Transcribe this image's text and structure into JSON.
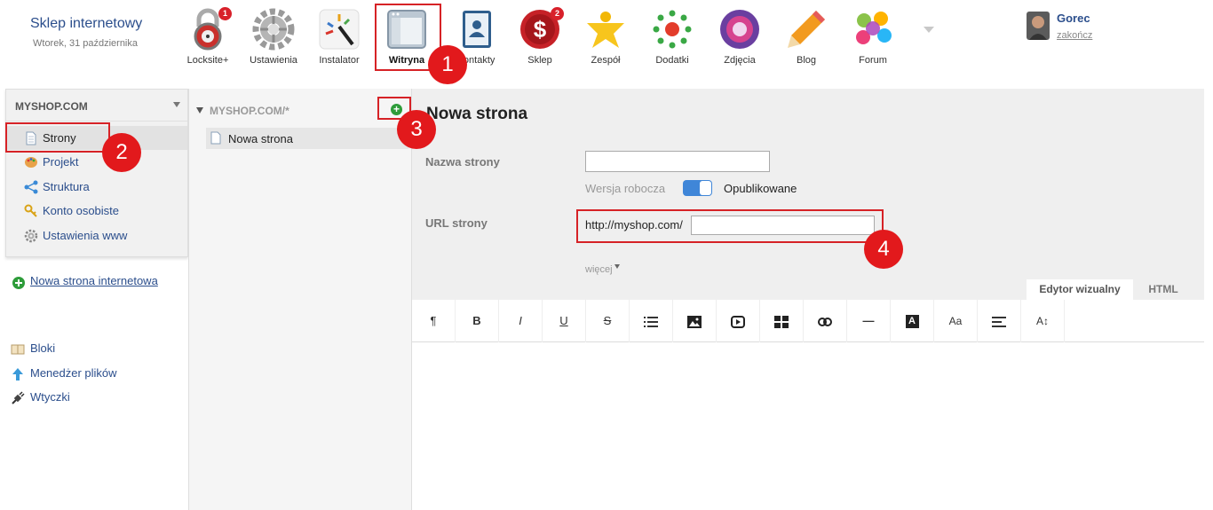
{
  "header": {
    "site_title": "Sklep internetowy",
    "site_date": "Wtorek, 31 października",
    "apps": [
      {
        "label": "Locksite+",
        "icon": "lock-icon",
        "badge": "1"
      },
      {
        "label": "Ustawienia",
        "icon": "gear-icon"
      },
      {
        "label": "Instalator",
        "icon": "magic-wand-icon"
      },
      {
        "label": "Witryna",
        "icon": "website-layout-icon",
        "active": true
      },
      {
        "label": "Kontakty",
        "icon": "contacts-book-icon"
      },
      {
        "label": "Sklep",
        "icon": "shop-dollar-icon",
        "badge": "2"
      },
      {
        "label": "Zespół",
        "icon": "team-star-icon"
      },
      {
        "label": "Dodatki",
        "icon": "addons-dots-icon"
      },
      {
        "label": "Zdjęcia",
        "icon": "photos-lens-icon"
      },
      {
        "label": "Blog",
        "icon": "pencil-icon"
      },
      {
        "label": "Forum",
        "icon": "forum-colorful-icon"
      }
    ],
    "user": {
      "name": "Gorec",
      "logout": "zakończ"
    }
  },
  "markers": [
    "1",
    "2",
    "3",
    "4"
  ],
  "sidebar": {
    "domain": "MYSHOP.COM",
    "menu": [
      {
        "label": "Strony",
        "icon": "page-icon",
        "active": true
      },
      {
        "label": "Projekt",
        "icon": "palette-icon"
      },
      {
        "label": "Struktura",
        "icon": "sitemap-icon"
      },
      {
        "label": "Konto osobiste",
        "icon": "key-icon"
      },
      {
        "label": "Ustawienia www",
        "icon": "gear-icon"
      }
    ],
    "new_site_link": "Nowa strona internetowa",
    "links": [
      {
        "label": "Bloki",
        "icon": "blocks-icon"
      },
      {
        "label": "Menedżer plików",
        "icon": "upload-arrow-icon"
      },
      {
        "label": "Wtyczki",
        "icon": "plug-icon"
      }
    ]
  },
  "tree": {
    "root": "MYSHOP.COM/*",
    "items": [
      {
        "label": "Nowa strona"
      }
    ]
  },
  "form": {
    "title": "Nowa strona",
    "name_label": "Nazwa strony",
    "name_value": "",
    "draft_label": "Wersja robocza",
    "published_label": "Opublikowane",
    "url_label": "URL strony",
    "url_prefix": "http://myshop.com/",
    "url_value": "",
    "more_label": "więcej"
  },
  "editor": {
    "tab_visual": "Edytor wizualny",
    "tab_html": "HTML",
    "tools": [
      {
        "name": "paragraph",
        "glyph": "¶"
      },
      {
        "name": "bold",
        "glyph": "B"
      },
      {
        "name": "italic",
        "glyph": "I"
      },
      {
        "name": "underline",
        "glyph": "U"
      },
      {
        "name": "strikethrough",
        "glyph": "S"
      },
      {
        "name": "list",
        "glyph": "list"
      },
      {
        "name": "image",
        "glyph": "image"
      },
      {
        "name": "video",
        "glyph": "video"
      },
      {
        "name": "table",
        "glyph": "table"
      },
      {
        "name": "link",
        "glyph": "link"
      },
      {
        "name": "horizontal-rule",
        "glyph": "—"
      },
      {
        "name": "text-color",
        "glyph": "A"
      },
      {
        "name": "font-size",
        "glyph": "Aa"
      },
      {
        "name": "align",
        "glyph": "align"
      },
      {
        "name": "line-height",
        "glyph": "A↕"
      }
    ]
  },
  "colors": {
    "accent": "#2b4e8c",
    "marker": "#e2191c",
    "toggle": "#3f86d8",
    "add": "#2e9c3a"
  }
}
